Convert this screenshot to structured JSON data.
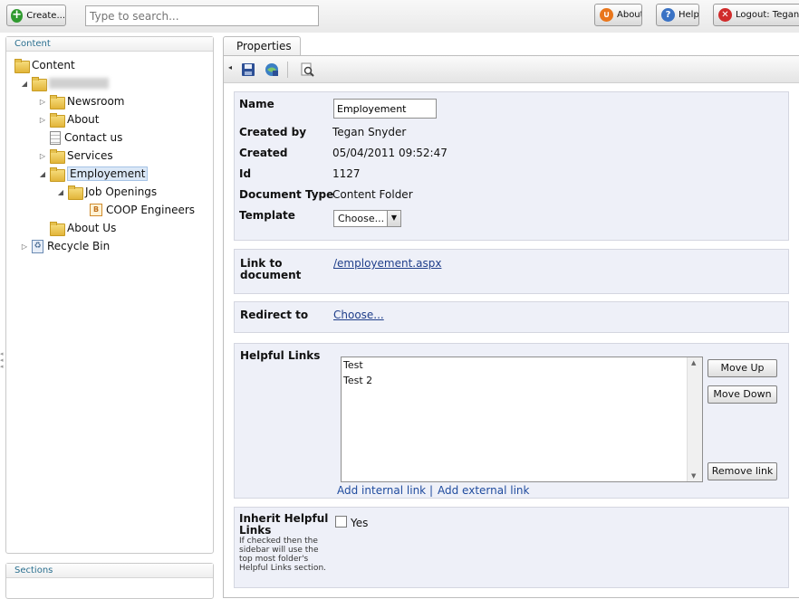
{
  "topbar": {
    "create_label": "Create...",
    "search_placeholder": "Type to search...",
    "about_label": "About",
    "help_label": "Help",
    "logout_label": "Logout: Tegan Sn"
  },
  "left": {
    "content_title": "Content",
    "tree": {
      "root": "Content",
      "newsroom": "Newsroom",
      "about": "About",
      "contact": "Contact us",
      "services": "Services",
      "employement": "Employement",
      "job_openings": "Job Openings",
      "coop": "COOP Engineers",
      "about_us": "About Us",
      "recycle_bin": "Recycle Bin"
    },
    "sections_title": "Sections"
  },
  "tabs": {
    "properties": "Properties"
  },
  "form": {
    "name_label": "Name",
    "name_value": "Employement",
    "created_by_label": "Created by",
    "created_by_value": "Tegan Snyder",
    "created_label": "Created",
    "created_value": "05/04/2011 09:52:47",
    "id_label": "Id",
    "id_value": "1127",
    "doctype_label": "Document Type",
    "doctype_value": "Content Folder",
    "template_label": "Template",
    "template_value": "Choose...",
    "link_label_1": "Link to",
    "link_label_2": "document",
    "link_value": "/employement.aspx",
    "redirect_label": "Redirect to",
    "redirect_value": "Choose...",
    "helpful_label": "Helpful Links",
    "helpful_items": [
      "Test",
      "Test 2"
    ],
    "move_up": "Move Up",
    "move_down": "Move Down",
    "remove_link": "Remove link",
    "add_internal": "Add internal link",
    "separator": "|",
    "add_external": "Add external link",
    "inherit_label_1": "Inherit Helpful",
    "inherit_label_2": "Links",
    "inherit_desc_1": "If checked then the",
    "inherit_desc_2": "sidebar will use the",
    "inherit_desc_3": "top most folder's",
    "inherit_desc_4": "Helpful Links section.",
    "inherit_checkbox_label": "Yes"
  },
  "colors": {
    "accent_green": "#2f9a2f",
    "about_orange": "#e9761c",
    "help_blue": "#3a72c4",
    "logout_red": "#d02b2b",
    "section_bg": "#eef0f8",
    "link_blue": "#1f3e8a"
  }
}
